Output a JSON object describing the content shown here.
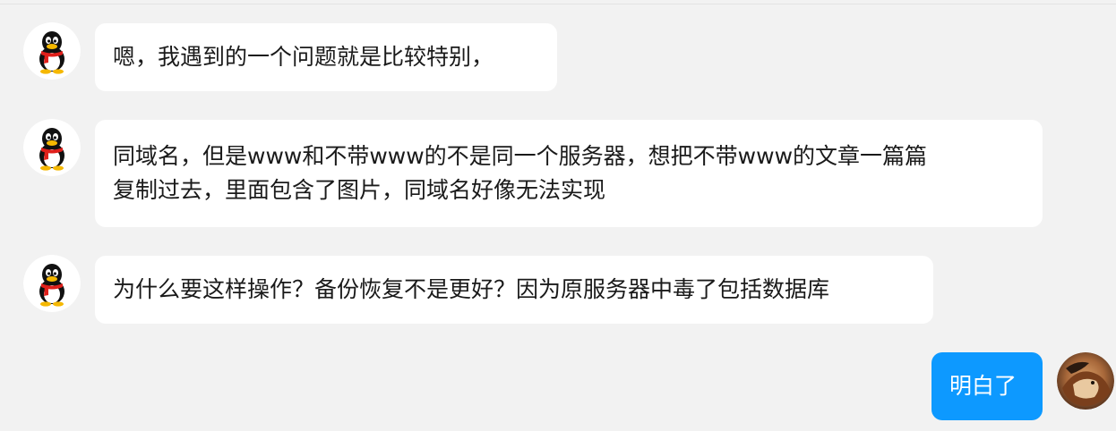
{
  "messages": [
    {
      "sender": "other",
      "avatar_icon": "qq-penguin-icon",
      "lines": [
        "嗯，我遇到的一个问题就是比较特别，"
      ]
    },
    {
      "sender": "other",
      "avatar_icon": "qq-penguin-icon",
      "lines": [
        "同域名，但是www和不带www的不是同一个服务器，想把不带www的文章一篇篇",
        "复制过去，里面包含了图片，同域名好像无法实现"
      ]
    },
    {
      "sender": "other",
      "avatar_icon": "qq-penguin-icon",
      "lines": [
        "为什么要这样操作？备份恢复不是更好？因为原服务器中毒了包括数据库"
      ]
    },
    {
      "sender": "self",
      "avatar_icon": "user-photo-avatar",
      "lines": [
        "明白了"
      ]
    }
  ],
  "colors": {
    "background": "#f2f2f2",
    "bubble_other": "#ffffff",
    "bubble_self": "#0d99ff",
    "text_other": "#1a1a1a",
    "text_self": "#ffffff"
  }
}
